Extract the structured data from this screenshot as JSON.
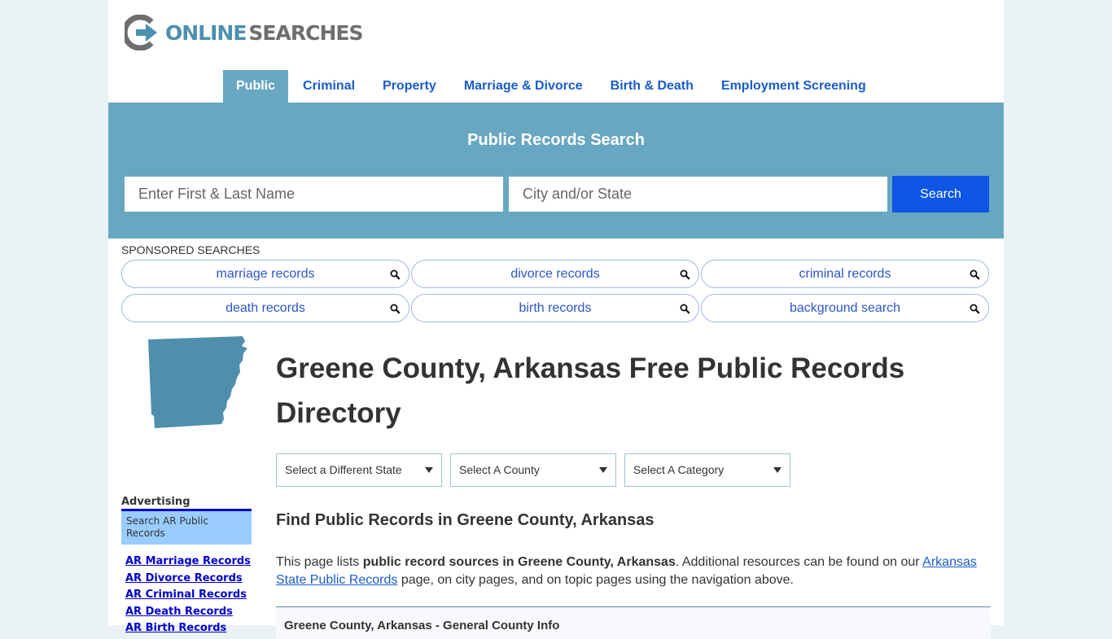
{
  "header": {
    "logo_online": "ONLINE",
    "logo_searches": "SEARCHES"
  },
  "nav": {
    "items": [
      {
        "label": "Public",
        "active": true
      },
      {
        "label": "Criminal"
      },
      {
        "label": "Property"
      },
      {
        "label": "Marriage & Divorce"
      },
      {
        "label": "Birth & Death"
      },
      {
        "label": "Employment Screening"
      }
    ]
  },
  "search": {
    "title": "Public Records Search",
    "name_placeholder": "Enter First & Last Name",
    "city_placeholder": "City and/or State",
    "button_label": "Search"
  },
  "sponsored": {
    "label": "SPONSORED SEARCHES",
    "items": [
      {
        "label": "marriage records",
        "icon": "search-icon"
      },
      {
        "label": "divorce records",
        "icon": "search-icon"
      },
      {
        "label": "criminal records",
        "icon": "search-icon"
      },
      {
        "label": "death records",
        "icon": "search-icon"
      },
      {
        "label": "birth records",
        "icon": "search-icon"
      },
      {
        "label": "background search",
        "icon": "search-icon"
      }
    ]
  },
  "sidebar": {
    "state_map_icon": "arkansas-map-icon",
    "ad_label": "Advertising",
    "ad_box": "Search AR Public Records",
    "links": [
      "AR Marriage Records",
      "AR Divorce Records",
      "AR Criminal Records",
      "AR Death Records",
      "AR Birth Records"
    ]
  },
  "main": {
    "title": "Greene County, Arkansas Free Public Records Directory",
    "selects": [
      "Select a Different State",
      "Select A County",
      "Select A Category"
    ],
    "subheading": "Find Public Records in Greene County, Arkansas",
    "intro": {
      "before": "This page lists ",
      "bold": "public record sources in Greene County, Arkansas",
      "middle": ". Additional resources can be found on our ",
      "link": "Arkansas State Public Records",
      "after": " page, on city pages, and on topic pages using the navigation above."
    },
    "info_box_title": "Greene County, Arkansas - General County Info"
  },
  "colors": {
    "brand_blue": "#68a7c2",
    "search_button": "#0d56e6",
    "nav_link": "#1a5cc8",
    "ad_box": "#99ccff",
    "sidebar_link": "#0000cc"
  }
}
